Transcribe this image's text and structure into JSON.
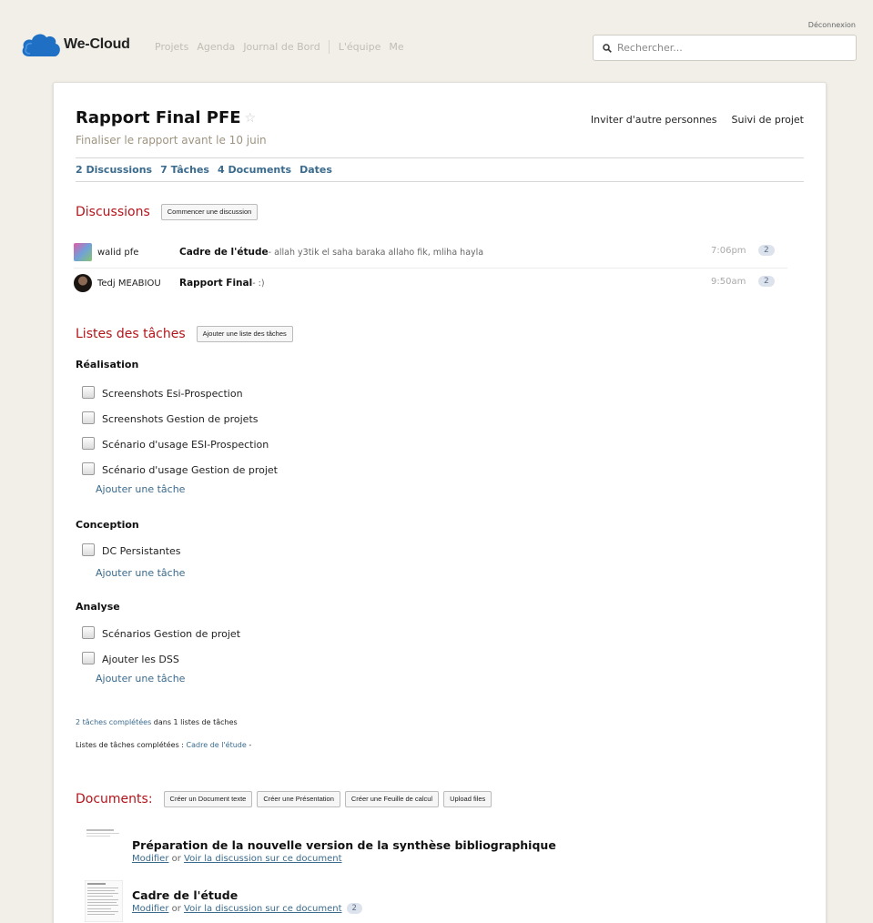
{
  "header": {
    "logout": "Déconnexion",
    "brand": "We-Cloud",
    "nav": [
      "Projets",
      "Agenda",
      "Journal de Bord",
      "L'équipe",
      "Me"
    ],
    "search_placeholder": "Rechercher..."
  },
  "project": {
    "title": "Rapport Final PFE",
    "subtitle": "Finaliser le rapport avant le 10 juin",
    "actions": [
      "Inviter d'autre personnes",
      "Suivi de projet"
    ],
    "counts": [
      "2 Discussions",
      "7 Tâches",
      "4 Documents",
      "Dates"
    ]
  },
  "discussions": {
    "heading": "Discussions",
    "button": "Commencer une discussion",
    "items": [
      {
        "author": "walid pfe",
        "title": "Cadre de l'étude",
        "excerpt": " - allah y3tik el saha baraka allaho fik, mliha hayla",
        "time": "7:06pm",
        "count": "2"
      },
      {
        "author": "Tedj MEABIOU",
        "title": "Rapport Final",
        "excerpt": " - :)",
        "time": "9:50am",
        "count": "2"
      }
    ]
  },
  "tasks": {
    "heading": "Listes des tâches",
    "button": "Ajouter une liste des tâches",
    "add_task": "Ajouter une tâche",
    "groups": [
      {
        "name": "Réalisation",
        "items": [
          "Screenshots Esi-Prospection",
          "Screenshots Gestion de projets",
          "Scénario d'usage ESI-Prospection",
          "Scénario d'usage Gestion de projet"
        ]
      },
      {
        "name": "Conception",
        "items": [
          "DC Persistantes"
        ]
      },
      {
        "name": "Analyse",
        "items": [
          "Scénarios Gestion de projet",
          "Ajouter les DSS"
        ]
      }
    ],
    "completed_link": "2 tâches complétées",
    "completed_rest": " dans 1 listes de tâches",
    "completed_lists_label": "Listes de tâches complétées : ",
    "completed_lists_link": "Cadre de l'étude",
    "completed_lists_tail": " -"
  },
  "documents": {
    "heading": "Documents:",
    "buttons": [
      "Créer un Document texte",
      "Créer une Présentation",
      "Créer une Feuille de calcul",
      "Upload files"
    ],
    "items": [
      {
        "title": "Préparation de la nouvelle version de la synthèse bibliographique",
        "edit": "Modifier",
        "or": " or ",
        "discuss": "Voir la discussion sur ce document",
        "count": ""
      },
      {
        "title": "Cadre de l'étude",
        "edit": "Modifier",
        "or": " or ",
        "discuss": "Voir la discussion sur ce document",
        "count": "2"
      }
    ]
  },
  "colors": {
    "accent_red": "#b3141b",
    "link_blue": "#3a6a8c",
    "brand_blue": "#1f6fc4"
  }
}
